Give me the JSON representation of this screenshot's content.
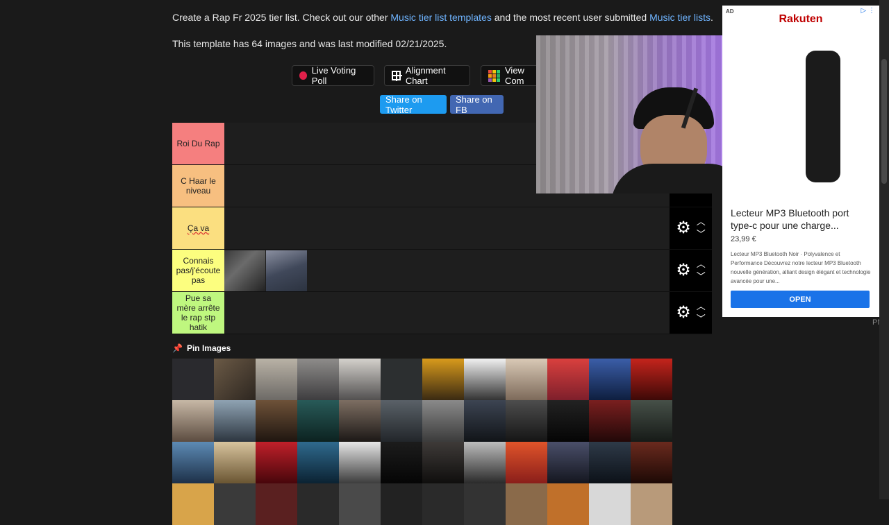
{
  "intro": {
    "prefix": "Create a Rap Fr 2025 tier list. Check out our other ",
    "link1": "Music tier list templates",
    "middle": " and the most recent user submitted ",
    "link2": "Music tier lists",
    "suffix": "."
  },
  "meta_text": "This template has 64 images and was last modified 02/21/2025.",
  "buttons": {
    "live_poll": "Live Voting Poll",
    "alignment": "Alignment Chart",
    "view_com": "View Com",
    "share_twitter": "Share on Twitter",
    "share_fb": "Share on FB"
  },
  "tiers": [
    {
      "label": "Roi Du Rap",
      "color": "#f57f7f"
    },
    {
      "label": "C Haar le niveau",
      "color": "#f7bf80"
    },
    {
      "label": "Ça va",
      "color": "#fbdf80"
    },
    {
      "label": "Connais pas/j'écoute pas",
      "color": "#fcfe7f"
    },
    {
      "label": "Pue sa mère arrête le rap stp hatik",
      "color": "#bff77f"
    }
  ],
  "pin_label": "Pin Images",
  "ad": {
    "badge": "AD",
    "brand": "Rakuten",
    "title": "Lecteur MP3 Bluetooth port type-c pour une charge...",
    "price": "23,99 €",
    "desc": "Lecteur MP3 Bluetooth Noir · Polyvalence et Performance Découvrez notre lecteur MP3 Bluetooth nouvelle génération, alliant design élégant et technologie avancée pour une...",
    "cta": "OPEN"
  },
  "pn": "PN",
  "icons": {
    "gear": "gear-icon",
    "up": "chevron-up-icon",
    "down": "chevron-down-icon",
    "pin": "pin-icon",
    "record": "record-icon",
    "grid": "grid-icon"
  }
}
